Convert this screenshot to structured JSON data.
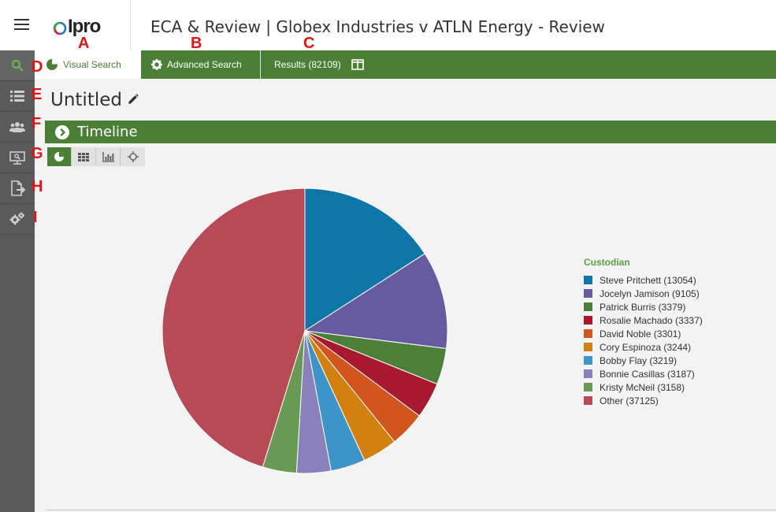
{
  "header": {
    "title": "ECA & Review | Globex Industries v ATLN Energy - Review",
    "logo_text": "Ipro"
  },
  "tabs": [
    {
      "label": "Visual Search",
      "icon": "pie-chart-icon"
    },
    {
      "label": "Advanced Search",
      "icon": "gear-icon"
    },
    {
      "label": "Results (82109)",
      "icon": "columns-icon"
    }
  ],
  "sidebar": {
    "items": [
      {
        "icon": "search-icon"
      },
      {
        "icon": "list-icon"
      },
      {
        "icon": "users-icon"
      },
      {
        "icon": "monitor-icon"
      },
      {
        "icon": "document-export-icon"
      },
      {
        "icon": "settings-gears-icon"
      }
    ]
  },
  "annotations": {
    "a": "A",
    "b": "B",
    "c": "C",
    "d": "D",
    "e": "E",
    "f": "F",
    "g": "G",
    "h": "H",
    "i": "I"
  },
  "document": {
    "title": "Untitled"
  },
  "section": {
    "label": "Timeline"
  },
  "view_toggle": [
    {
      "icon": "pie-chart-icon",
      "active": true
    },
    {
      "icon": "grid-icon",
      "active": false
    },
    {
      "icon": "bar-chart-icon",
      "active": false
    },
    {
      "icon": "sunburst-icon",
      "active": false
    }
  ],
  "colors": {
    "brand_green": "#4b7f35",
    "legend_title": "#5ba044"
  },
  "chart_data": {
    "type": "pie",
    "legend_title": "Custodian",
    "legend_position": "right",
    "slices": [
      {
        "name": "Steve Pritchett",
        "value": 13054,
        "label": "Steve Pritchett (13054)",
        "color": "#0f76a8"
      },
      {
        "name": "Jocelyn Jamison",
        "value": 9105,
        "label": "Jocelyn Jamison (9105)",
        "color": "#665ba1"
      },
      {
        "name": "Patrick Burris",
        "value": 3379,
        "label": "Patrick Burris (3379)",
        "color": "#4c7f37"
      },
      {
        "name": "Rosalie Machado",
        "value": 3337,
        "label": "Rosalie Machado (3337)",
        "color": "#a8182f"
      },
      {
        "name": "David Noble",
        "value": 3301,
        "label": "David Noble (3301)",
        "color": "#d2561c"
      },
      {
        "name": "Cory Espinoza",
        "value": 3244,
        "label": "Cory Espinoza (3244)",
        "color": "#d3800f"
      },
      {
        "name": "Bobby Flay",
        "value": 3219,
        "label": "Bobby Flay (3219)",
        "color": "#3b95c9"
      },
      {
        "name": "Bonnie Casillas",
        "value": 3187,
        "label": "Bonnie Casillas (3187)",
        "color": "#8a80bb"
      },
      {
        "name": "Kristy McNeil",
        "value": 3158,
        "label": "Kristy McNeil (3158)",
        "color": "#679a54"
      },
      {
        "name": "Other",
        "value": 37125,
        "label": "Other (37125)",
        "color": "#b84a55"
      }
    ]
  }
}
